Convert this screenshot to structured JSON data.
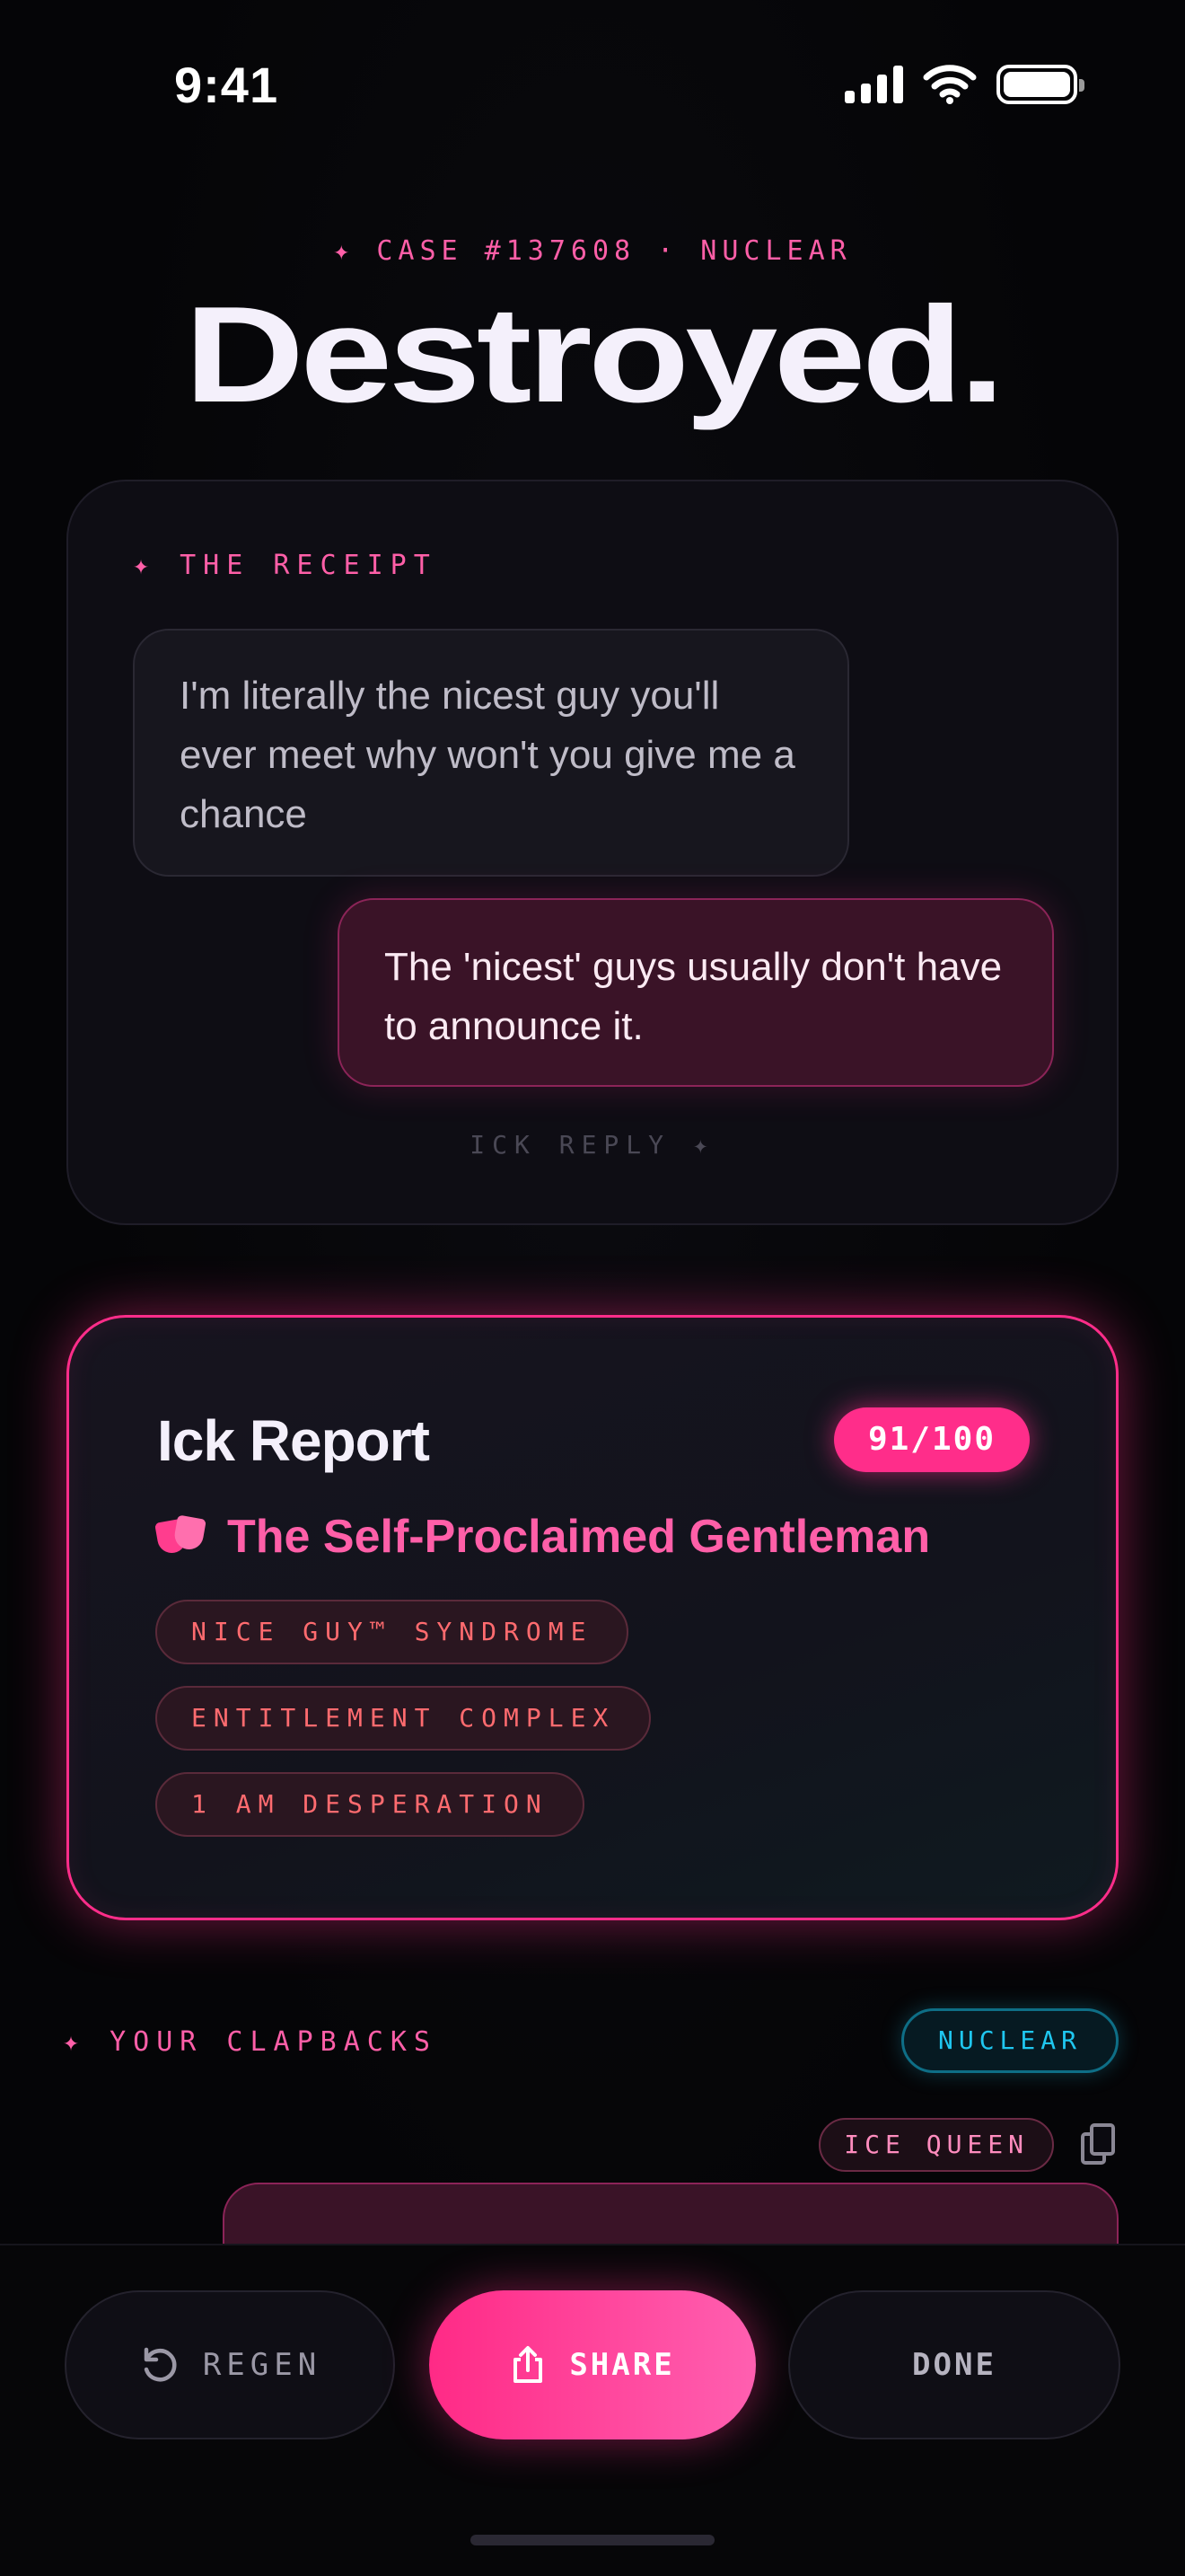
{
  "status_bar": {
    "time": "9:41"
  },
  "header": {
    "case_line": "✦ CASE #137608 · NUCLEAR",
    "title": "Destroyed."
  },
  "receipt": {
    "label": "✦ THE RECEIPT",
    "their_message": "I'm literally the nicest guy you'll ever meet why won't you give me a chance",
    "reply_message": "The 'nicest' guys usually don't have to announce it.",
    "reply_label": "ICK REPLY ✦"
  },
  "report": {
    "title": "Ick Report",
    "score": "91/100",
    "archetype_icon": "theater-masks-icon",
    "archetype": "The Self-Proclaimed Gentleman",
    "tags": [
      "NICE GUY™ SYNDROME",
      "ENTITLEMENT COMPLEX",
      "1 AM DESPERATION"
    ]
  },
  "clapbacks": {
    "label": "✦ YOUR CLAPBACKS",
    "mode": "NUCLEAR",
    "first": {
      "style": "ICE QUEEN",
      "text": ""
    }
  },
  "actions": {
    "regen": "REGEN",
    "share": "SHARE",
    "done": "DONE"
  },
  "colors": {
    "accent": "#ff2d8a",
    "accent_text": "#ff5fa8",
    "cyan": "#1fc7f0",
    "tag_text": "#ff6b6f",
    "background": "#050507"
  }
}
